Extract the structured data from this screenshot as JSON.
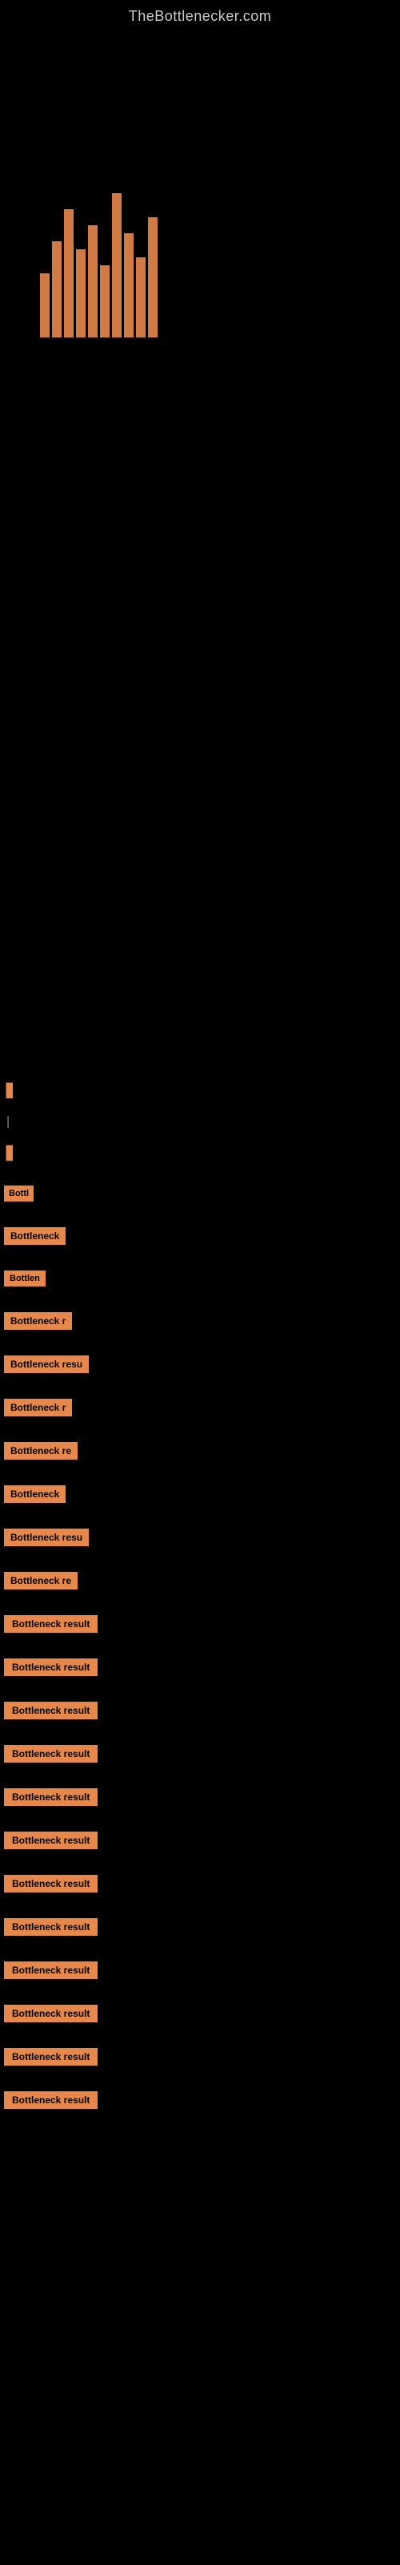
{
  "site": {
    "title": "TheBottlenecker.com"
  },
  "bottleneck_items": [
    {
      "id": 1,
      "label": "Bottl",
      "size": "small"
    },
    {
      "id": 2,
      "label": "Bottleneck",
      "size": "medium"
    },
    {
      "id": 3,
      "label": "Bottlen",
      "size": "small-medium"
    },
    {
      "id": 4,
      "label": "Bottleneck r",
      "size": "medium"
    },
    {
      "id": 5,
      "label": "Bottleneck resu",
      "size": "medium-large"
    },
    {
      "id": 6,
      "label": "Bottleneck r",
      "size": "medium"
    },
    {
      "id": 7,
      "label": "Bottleneck re",
      "size": "medium"
    },
    {
      "id": 8,
      "label": "Bottleneck",
      "size": "medium"
    },
    {
      "id": 9,
      "label": "Bottleneck resu",
      "size": "medium-large"
    },
    {
      "id": 10,
      "label": "Bottleneck re",
      "size": "medium"
    },
    {
      "id": 11,
      "label": "Bottleneck result",
      "size": "large"
    },
    {
      "id": 12,
      "label": "Bottleneck result",
      "size": "large"
    },
    {
      "id": 13,
      "label": "Bottleneck result",
      "size": "large"
    },
    {
      "id": 14,
      "label": "Bottleneck result",
      "size": "large"
    },
    {
      "id": 15,
      "label": "Bottleneck result",
      "size": "large"
    },
    {
      "id": 16,
      "label": "Bottleneck result",
      "size": "large"
    },
    {
      "id": 17,
      "label": "Bottleneck result",
      "size": "large"
    },
    {
      "id": 18,
      "label": "Bottleneck result",
      "size": "large"
    },
    {
      "id": 19,
      "label": "Bottleneck result",
      "size": "large"
    },
    {
      "id": 20,
      "label": "Bottleneck result",
      "size": "large"
    },
    {
      "id": 21,
      "label": "Bottleneck result",
      "size": "large"
    },
    {
      "id": 22,
      "label": "Bottleneck result",
      "size": "large"
    }
  ],
  "indicators": {
    "input_label": "|",
    "cursor_label": "▋"
  }
}
